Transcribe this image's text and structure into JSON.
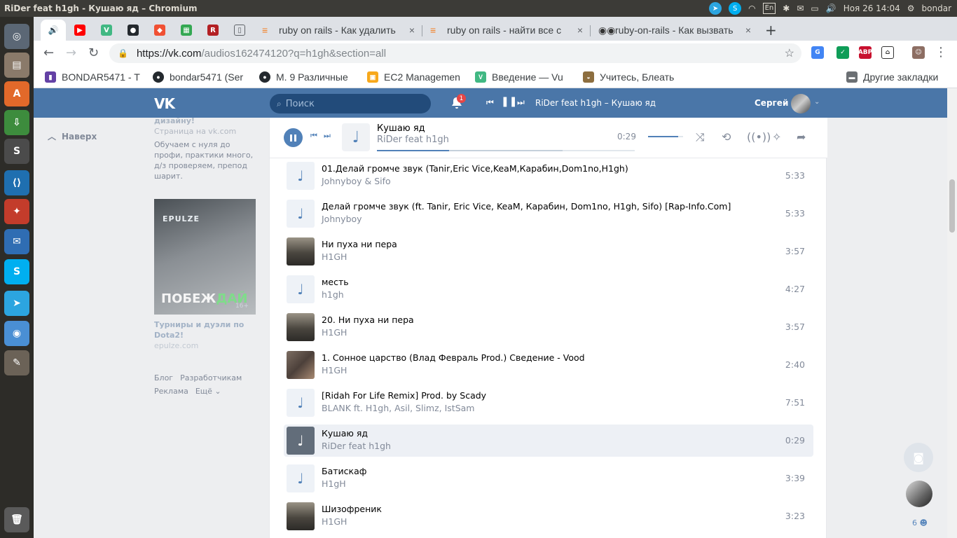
{
  "os": {
    "window_title": "RiDer feat h1gh - Кушаю яд – Chromium",
    "lang": "En",
    "clock": "Ноя 26 14:04",
    "user": "bondar"
  },
  "launcher": {
    "items": [
      {
        "icon": "ubuntu-logo-icon"
      },
      {
        "icon": "files-icon"
      },
      {
        "icon": "software-center-icon",
        "letter": "A"
      },
      {
        "icon": "downloader-icon"
      },
      {
        "icon": "sublime-text-icon",
        "letter": "S"
      },
      {
        "icon": "vscode-icon"
      },
      {
        "icon": "system-settings-icon"
      },
      {
        "icon": "thunderbird-icon"
      },
      {
        "icon": "skype-icon",
        "letter": "S"
      },
      {
        "icon": "telegram-icon"
      },
      {
        "icon": "chromium-icon"
      },
      {
        "icon": "gimp-icon"
      },
      {
        "icon": "trash-icon"
      }
    ]
  },
  "tabs": {
    "pinned": [
      {
        "icon": "audio-icon",
        "glyph": "🔊"
      },
      {
        "icon": "youtube-icon",
        "glyph": "▶"
      },
      {
        "icon": "vue-icon",
        "glyph": "V"
      },
      {
        "icon": "github-icon",
        "glyph": "●"
      },
      {
        "icon": "git-icon",
        "glyph": "◆"
      },
      {
        "icon": "sheets-icon",
        "glyph": "▦"
      },
      {
        "icon": "redmine-icon",
        "glyph": "R"
      },
      {
        "icon": "doc-icon",
        "glyph": "▯"
      }
    ],
    "full": [
      {
        "title": "ruby on rails - Как удалить",
        "icon": "stackoverflow-icon"
      },
      {
        "title": "ruby on rails - найти все с",
        "icon": "stackoverflow-icon"
      },
      {
        "title": "ruby-on-rails - Как вызвать",
        "icon": "glasses-icon"
      }
    ],
    "close": "×",
    "new_tab": "+"
  },
  "toolbar": {
    "back": "←",
    "forward": "→",
    "reload": "↻",
    "url_host": "https://vk.com",
    "url_path": "/audios162474120?q=h1gh&section=all",
    "star": "☆",
    "menu": "⋮"
  },
  "bookmarks": [
    {
      "label": "BONDAR5471 - T",
      "icon": "twitch-icon"
    },
    {
      "label": "bondar5471 (Ser",
      "icon": "github-icon"
    },
    {
      "label": "М. 9 Различные",
      "icon": "github-icon"
    },
    {
      "label": "EC2 Managemen",
      "icon": "aws-icon"
    },
    {
      "label": "Введение — Vu",
      "icon": "vue-icon"
    },
    {
      "label": "Учитесь, Блеать",
      "icon": "cat-icon"
    },
    {
      "label": "Другие закладки",
      "icon": "folder-icon"
    }
  ],
  "vk": {
    "logo": "VK",
    "search_placeholder": "Поиск",
    "notif_count": "1",
    "header_track": "RiDer feat h1gh – Кушаю яд",
    "user_name": "Сергей",
    "up_link": "Наверх",
    "side": {
      "cut_title": "дизайну!",
      "page_note": "Страница на vk.com",
      "promo_text": "Обучаем с нуля до профи, практики много, д/з проверяем, препод шарит.",
      "ad_brand": "EPULZE",
      "ad_word_1": "ПОБЕЖ",
      "ad_word_2": "ДАЙ",
      "ad_age": "16+",
      "ad_title": "Турниры и дуэли по Dota2!",
      "ad_domain": "epulze.com",
      "footer": [
        "Блог",
        "Разработчикам",
        "Реклама",
        "Ещё ⌄"
      ]
    },
    "player": {
      "title": "Кушаю яд",
      "artist": "RiDer feat h1gh",
      "time": "0:29",
      "progress": 0.28,
      "buffered": 0.72,
      "volume": 0.85
    },
    "tracks": [
      {
        "title": "01.Делай громче звук (Tanir,Eric Vice,KeaM,Карабин,Dom1no,H1gh)",
        "artist": "Johnyboy & Sifo",
        "duration": "5:33",
        "cover": "note"
      },
      {
        "title": "Делай громче звук (ft. Tanir, Eric Vice, KeaM, Карабин, Dom1no, H1gh, Sifo) [Rap-Info.Com]",
        "artist": "Johnyboy",
        "duration": "5:33",
        "cover": "note"
      },
      {
        "title": "Ни пуха ни пера",
        "artist": "H1GH",
        "duration": "3:57",
        "cover": "photo"
      },
      {
        "title": "месть",
        "artist": "h1gh",
        "duration": "4:27",
        "cover": "note"
      },
      {
        "title": "20. Ни пуха ни пера",
        "artist": "H1GH",
        "duration": "3:57",
        "cover": "photo"
      },
      {
        "title": "1. Сонное царство (Влад Февраль Prod.) Сведение - Vood",
        "artist": "H1GH",
        "duration": "2:40",
        "cover": "photo2"
      },
      {
        "title": "[Ridah For Life Remix] Prod. by Scady",
        "artist": "BLANK ft. H1gh, Asil, Slimz, IstSam",
        "duration": "7:51",
        "cover": "note"
      },
      {
        "title": "Кушаю яд",
        "artist": "RiDer feat h1gh",
        "duration": "0:29",
        "cover": "playing"
      },
      {
        "title": "Батискаф",
        "artist": "H1gH",
        "duration": "3:39",
        "cover": "note"
      },
      {
        "title": "Шизофреник",
        "artist": "H1GH",
        "duration": "3:23",
        "cover": "photo"
      }
    ],
    "right_widget_count": "6"
  },
  "colors": {
    "vk_blue": "#4a76a8",
    "accent": "#5181b8",
    "muted": "#828a99"
  }
}
